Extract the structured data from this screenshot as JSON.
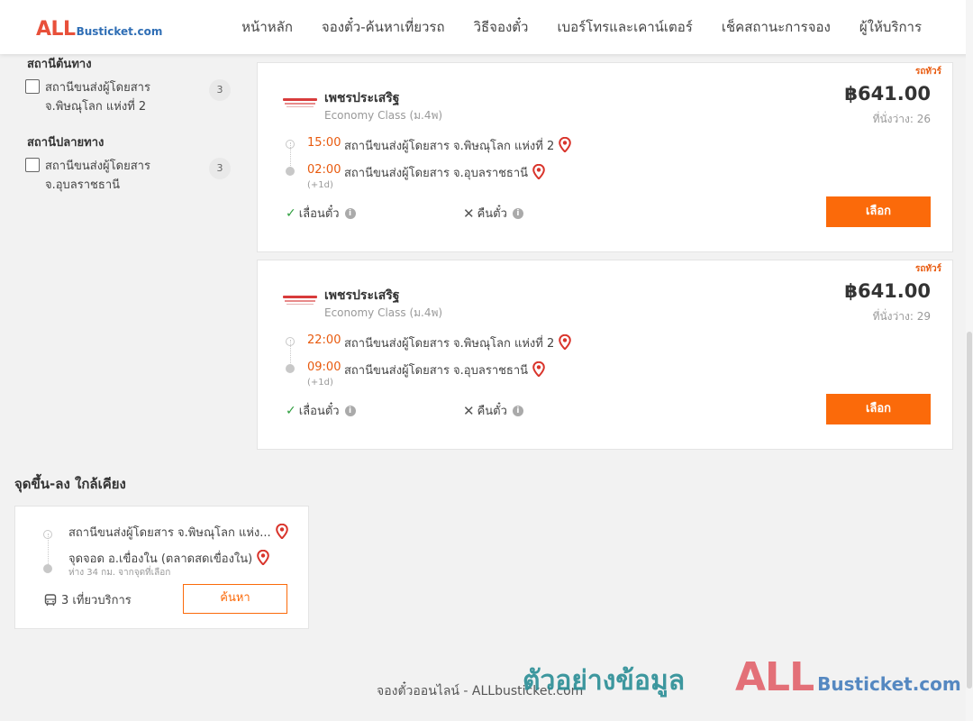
{
  "header": {
    "logo_all": "ALL",
    "logo_rest": "Busticket.com",
    "nav": [
      "หน้าหลัก",
      "จองตั๋ว-ค้นหาเที่ยวรถ",
      "วิธีจองตั๋ว",
      "เบอร์โทรและเคาน์เตอร์",
      "เช็คสถานะการจอง",
      "ผู้ให้บริการ"
    ]
  },
  "filters": {
    "origin_title": "สถานีต้นทาง",
    "origin": {
      "label": "สถานีขนส่งผู้โดยสาร จ.พิษณุโลก แห่งที่ 2",
      "count": "3",
      "checked": false
    },
    "dest_title": "สถานีปลายทาง",
    "dest": {
      "label": "สถานีขนส่งผู้โดยสาร จ.อุบลราชธานี",
      "count": "3",
      "checked": false
    }
  },
  "trips": [
    {
      "tag": "รถทัวร์",
      "operator": "เพชรประเสริฐ",
      "class": "Economy Class (ม.4พ)",
      "price": "฿641.00",
      "seats": "ที่นั่งว่าง: 26",
      "dep_time": "15:00",
      "dep_stop": "สถานีขนส่งผู้โดยสาร จ.พิษณุโลก แห่งที่ 2",
      "arr_time": "02:00",
      "arr_stop": "สถานีขนส่งผู้โดยสาร จ.อุบลราชธานี",
      "plus_day": "(+1d)",
      "policy_change": "เลื่อนตั๋ว",
      "policy_refund": "คืนตั๋ว",
      "select": "เลือก"
    },
    {
      "tag": "รถทัวร์",
      "operator": "เพชรประเสริฐ",
      "class": "Economy Class (ม.4พ)",
      "price": "฿641.00",
      "seats": "ที่นั่งว่าง: 29",
      "dep_time": "22:00",
      "dep_stop": "สถานีขนส่งผู้โดยสาร จ.พิษณุโลก แห่งที่ 2",
      "arr_time": "09:00",
      "arr_stop": "สถานีขนส่งผู้โดยสาร จ.อุบลราชธานี",
      "plus_day": "(+1d)",
      "policy_change": "เลื่อนตั๋ว",
      "policy_refund": "คืนตั๋ว",
      "select": "เลือก"
    }
  ],
  "nearby": {
    "title": "จุดขึ้น-ลง ใกล้เคียง",
    "from": "สถานีขนส่งผู้โดยสาร จ.พิษณุโลก แห่ง...",
    "to": "จุดจอด อ.เขื่องใน (ตลาดสดเขื่องใน)",
    "distance": "ห่าง 34 กม. จากจุดที่เลือก",
    "trips": "3 เที่ยวบริการ",
    "search": "ค้นหา"
  },
  "footer": {
    "text": "จองตั๋วออนไลน์ - ALLbusticket.com",
    "watermark_text": "ตัวอย่างข้อมูล",
    "watermark_all": "ALL",
    "watermark_rest": "Busticket.com"
  },
  "colors": {
    "accent_orange": "#fb6a0a",
    "time_orange": "#e85a0e",
    "pin_red": "#d9342b",
    "check_green": "#2e9e3e"
  },
  "icons": {
    "pin": "map-pin-icon",
    "info": "info-icon",
    "check": "check-icon",
    "cross": "cross-icon",
    "bus": "bus-icon"
  }
}
